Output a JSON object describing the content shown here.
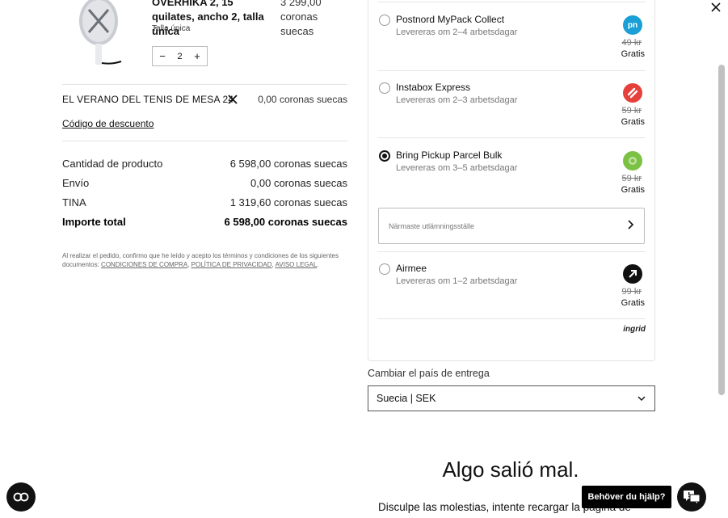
{
  "product": {
    "name": "OVERHIKA 2, 15 quilates, ancho 2, talla única",
    "price": "3 299,00 coronas suecas",
    "size": "Talla única",
    "quantity": "2",
    "minus": "−",
    "plus": "+"
  },
  "promo": {
    "code": "EL VERANO DEL TENIS DE MESA 24",
    "amount": "0,00 coronas suecas",
    "discount_link": "Código de descuento"
  },
  "summary": {
    "rows": [
      {
        "label": "Cantidad de producto",
        "value": "6 598,00 coronas suecas"
      },
      {
        "label": "Envío",
        "value": "0,00 coronas suecas"
      },
      {
        "label": "TINA",
        "value": "1 319,60 coronas suecas"
      }
    ],
    "total_label": "Importe total",
    "total_value": "6 598,00 coronas suecas"
  },
  "legal": {
    "text": "Al realizar el pedido, confirmo que he leído y acepto los términos y condiciones de los siguientes documentos:",
    "link_terms": "CONDICIONES DE COMPRA",
    "sep1": ",",
    "link_privacy": "POLÍTICA DE PRIVACIDAD",
    "sep2": ",",
    "link_legal": "AVISO LEGAL",
    "end": "."
  },
  "shipping": {
    "options": [
      {
        "name": "Postnord MyPack Collect",
        "eta": "Levereras om 2–4 arbetsdagar",
        "old_price": "49 kr",
        "price": "Gratis",
        "logo_text": "pn",
        "logo_color": "#1a9fd6"
      },
      {
        "name": "Instabox Express",
        "eta": "Levereras om 2–3 arbetsdagar",
        "old_price": "59 kr",
        "price": "Gratis",
        "logo_text": "",
        "logo_color": "#e5403b"
      },
      {
        "name": "Bring Pickup Parcel Bulk",
        "eta": "Levereras om 3–5 arbetsdagar",
        "old_price": "59 kr",
        "price": "Gratis",
        "logo_text": "",
        "logo_color": "#7bc144"
      },
      {
        "name": "Airmee",
        "eta": "Levereras om 1–2 arbetsdagar",
        "old_price": "99 kr",
        "price": "Gratis",
        "logo_text": "",
        "logo_color": "#111111"
      }
    ],
    "selected_index": 2,
    "pickup_placeholder": "Närmaste utlämningsställe",
    "provider": "ingrid"
  },
  "country": {
    "label": "Cambiar el país de entrega",
    "selected": "Suecia | SEK"
  },
  "error": {
    "title": "Algo salió mal.",
    "text": "Disculpe las molestias, intente recargar la página de"
  },
  "help": {
    "label": "Behöver du hjälp?"
  }
}
